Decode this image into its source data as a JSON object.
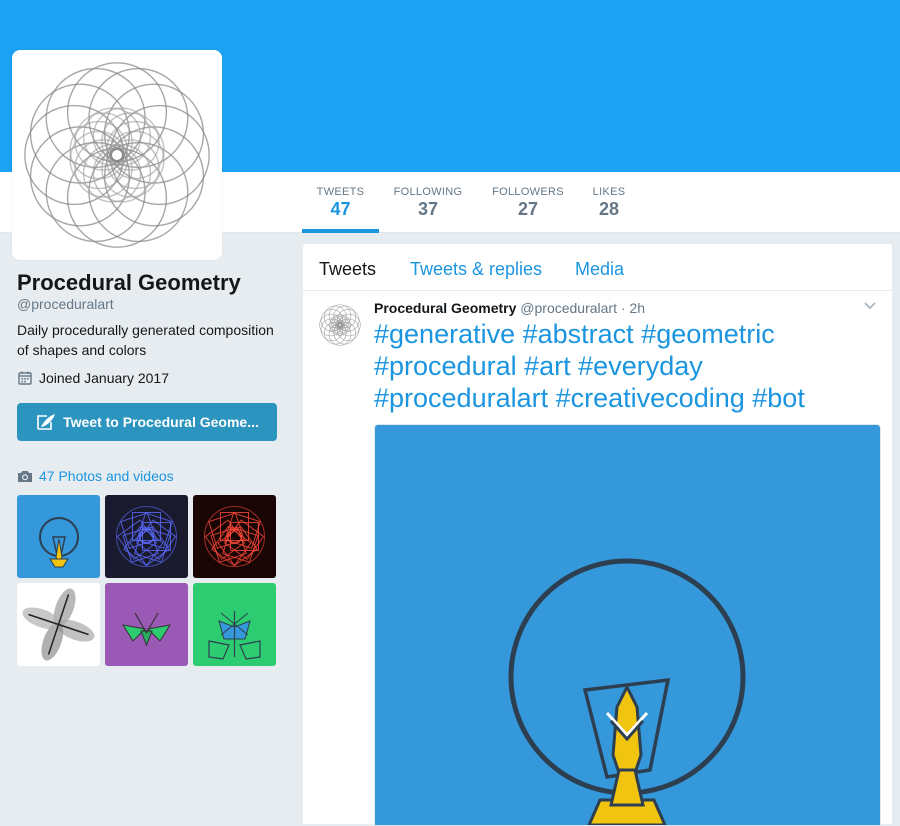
{
  "profile": {
    "name": "Procedural Geometry",
    "handle": "@proceduralart",
    "bio": "Daily procedurally generated composition of shapes and colors",
    "joined": "Joined January 2017",
    "tweet_to_label": "Tweet to Procedural Geome...",
    "photos_label": "47 Photos and videos"
  },
  "nav": {
    "tweets": {
      "label": "TWEETS",
      "value": "47"
    },
    "following": {
      "label": "FOLLOWING",
      "value": "37"
    },
    "followers": {
      "label": "FOLLOWERS",
      "value": "27"
    },
    "likes": {
      "label": "LIKES",
      "value": "28"
    }
  },
  "timeline_tabs": [
    "Tweets",
    "Tweets & replies",
    "Media"
  ],
  "tweet": {
    "name": "Procedural Geometry",
    "handle": "@proceduralart",
    "separator": "·",
    "time": "2h",
    "hashtags": [
      "#generative",
      "#abstract",
      "#geometric",
      "#procedural",
      "#art",
      "#everyday",
      "#proceduralart",
      "#creativecoding",
      "#bot"
    ]
  },
  "icons": {
    "calendar": "calendar-icon",
    "feather": "compose-feather-icon",
    "camera": "camera-icon",
    "caret": "chevron-down-icon"
  },
  "colors": {
    "banner": "#1da1f2",
    "accent": "#1b95e0",
    "tweet_button": "#2b95c0",
    "media_bg": "#3498db",
    "thumb_blue": "#3498db",
    "thumb_purple": "#9b59b6",
    "thumb_green": "#2ecc71"
  }
}
